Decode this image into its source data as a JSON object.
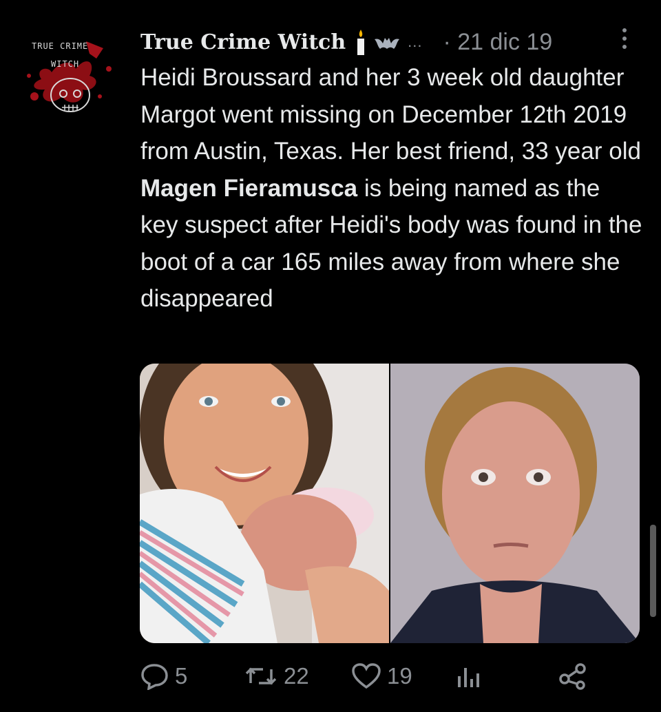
{
  "author": {
    "display_name": "True Crime Witch",
    "avatar_text_top": "TRUE CRIME",
    "avatar_text_bottom": "WITCH",
    "emoji": [
      "candle-emoji",
      "bat-emoji"
    ],
    "ellipsis": "...",
    "date": "· 21 dic 19"
  },
  "tweet": {
    "text_part1": "Heidi Broussard and her 3 week old daughter Margot went missing on December 12th 2019 from Austin, Texas. Her best friend, 33 year old ",
    "text_bold": "Magen Fieramusca",
    "text_part2": " is being named as the key suspect after Heidi's body was found in the boot of a car 165 miles away from where she disappeared"
  },
  "media": {
    "left_photo": "woman-holding-newborn-photo",
    "right_photo": "mugshot-photo"
  },
  "actions": {
    "reply_count": "5",
    "retweet_count": "22",
    "like_count": "19",
    "analytics_icon": "analytics-icon",
    "share_icon": "share-icon"
  },
  "colors": {
    "background": "#000000",
    "text": "#e7e9ea",
    "secondary": "#8b8f94",
    "blood": "#b0111a"
  }
}
